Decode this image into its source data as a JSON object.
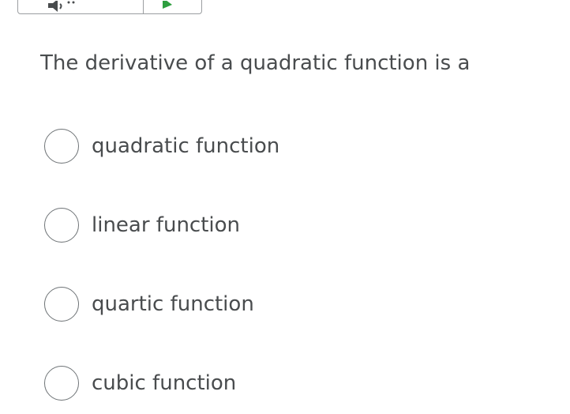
{
  "player": {
    "speaker_icon": "speaker-icon",
    "play_icon": "play-icon",
    "play_color": "#2e9e3f"
  },
  "question": {
    "text": "The derivative of a quadratic function is a"
  },
  "options": [
    {
      "label": "quadratic function",
      "selected": false
    },
    {
      "label": "linear function",
      "selected": false
    },
    {
      "label": "quartic function",
      "selected": false
    },
    {
      "label": "cubic function",
      "selected": false
    }
  ]
}
